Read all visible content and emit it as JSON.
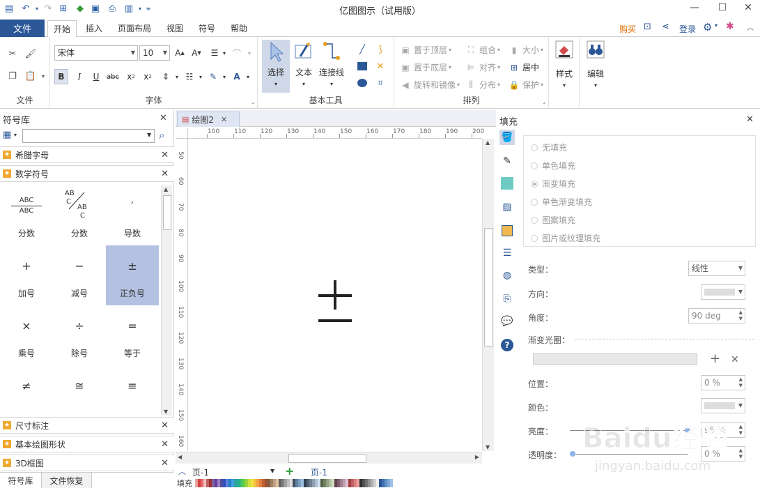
{
  "title_bar": {
    "app_title": "亿图图示（试用版）",
    "minimize_icon": "—",
    "maximize_icon": "☐",
    "close_icon": "✕"
  },
  "menu": {
    "file": "文件",
    "tabs": [
      "开始",
      "插入",
      "页面布局",
      "视图",
      "符号",
      "帮助"
    ],
    "buy": "购买",
    "login": "登录"
  },
  "ribbon": {
    "groups": {
      "file": "文件",
      "font": "字体",
      "basic_tools": "基本工具",
      "arrange": "排列"
    },
    "font_name": "宋体",
    "font_size": "10",
    "tools": {
      "select": "选择",
      "text": "文本",
      "connector": "连接线"
    },
    "arrange_items": {
      "bring_top": "置于顶层",
      "send_bottom": "置于底层",
      "rotate_mirror": "旋转和镜像",
      "group": "组合",
      "align": "对齐",
      "distribute": "分布",
      "size": "大小",
      "center": "居中",
      "protect": "保护"
    },
    "style": "样式",
    "edit": "编辑"
  },
  "library": {
    "title": "符号库",
    "search_value": "",
    "categories_top": [
      "希腊字母",
      "数学符号"
    ],
    "categories_bottom": [
      "尺寸标注",
      "基本绘图形状",
      "3D框图"
    ],
    "symbols": [
      {
        "glyph": "",
        "name": "分数"
      },
      {
        "glyph": "",
        "name": "分数"
      },
      {
        "glyph": "′",
        "name": "导数"
      },
      {
        "glyph": "+",
        "name": "加号"
      },
      {
        "glyph": "−",
        "name": "减号"
      },
      {
        "glyph": "±",
        "name": "正负号"
      },
      {
        "glyph": "×",
        "name": "乘号"
      },
      {
        "glyph": "÷",
        "name": "除号"
      },
      {
        "glyph": "=",
        "name": "等于"
      },
      {
        "glyph": "≠",
        "name": ""
      },
      {
        "glyph": "≅",
        "name": ""
      },
      {
        "glyph": "≡",
        "name": ""
      }
    ],
    "fraction1": {
      "num": "ABC",
      "den": "ABC"
    },
    "fraction2": {
      "a": "AB",
      "b": "C",
      "c": "AB",
      "d": "C"
    },
    "bottom_tabs": [
      "符号库",
      "文件恢复"
    ]
  },
  "document": {
    "tab": "绘图2",
    "page_selector": "页-1",
    "page_tab": "页-1",
    "fill_label": "填充",
    "ruler_h": [
      "100",
      "110",
      "120",
      "130",
      "140",
      "150",
      "160",
      "170",
      "180",
      "190",
      "200"
    ],
    "ruler_v": [
      "50",
      "60",
      "70",
      "80",
      "90",
      "100",
      "110",
      "120",
      "130",
      "140",
      "150",
      "160"
    ]
  },
  "fill_panel": {
    "title": "填充",
    "options": [
      "无填充",
      "单色填充",
      "渐变填充",
      "单色渐变填充",
      "图案填充",
      "图片或纹理填充"
    ],
    "selected_option": "渐变填充",
    "type_label": "类型：",
    "type_value": "线性",
    "direction_label": "方向：",
    "angle_label": "角度：",
    "angle_value": "90 deg",
    "gradient_stops_label": "渐变光圈：",
    "position_label": "位置：",
    "position_value": "0 %",
    "color_label": "颜色：",
    "brightness_label": "亮度：",
    "brightness_value": "95 %",
    "transparency_label": "透明度：",
    "transparency_value": "0 %"
  },
  "watermark": {
    "text": "Baidu经验",
    "url": "jingyan.baidu.com"
  },
  "colors": {
    "accent": "#2b5797",
    "selected_cell": "#b5c1e2",
    "buy": "#e06c00",
    "login": "#2b5797"
  }
}
